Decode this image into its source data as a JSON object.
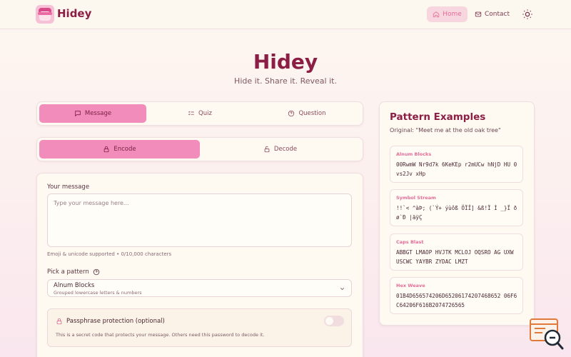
{
  "app": {
    "brand": "Hidey"
  },
  "nav": {
    "home": "Home",
    "contact": "Contact",
    "theme_icon": "sun-icon"
  },
  "hero": {
    "title": "Hidey",
    "subtitle": "Hide it. Share it. Reveal it."
  },
  "mode_tabs": [
    {
      "label": "Message",
      "icon": "speech-bubble-icon",
      "active": true
    },
    {
      "label": "Quiz",
      "icon": "checklist-icon",
      "active": false
    },
    {
      "label": "Question",
      "icon": "help-circle-icon",
      "active": false
    }
  ],
  "action_tabs": [
    {
      "label": "Encode",
      "icon": "lock-icon",
      "active": true
    },
    {
      "label": "Decode",
      "icon": "unlock-icon",
      "active": false
    }
  ],
  "form": {
    "message_label": "Your message",
    "message_placeholder": "Type your message here...",
    "message_help": "Emoji & unicode supported • 0/10,000 characters",
    "pattern_label": "Pick a pattern",
    "pattern_value": "Alnum Blocks",
    "pattern_desc": "Grouped lowercase letters & numbers",
    "passphrase_label": "Passphrase protection (optional)",
    "passphrase_help": "This is a secret code that protects your message. Others need this password to decode it.",
    "passphrase_enabled": false
  },
  "examples": {
    "title": "Pattern Examples",
    "original": "Original: \"Meet me at the old oak tree\"",
    "items": [
      {
        "name": "Alnum Blocks",
        "code": "00RwmW Nr9d7k 6KeKEp r2mUCw hNjD HU 0vs2Jv xHp"
      },
      {
        "name": "Symbol Stream",
        "code": "!!`< ^àÞ; (`Ý+ ýùôß ÖÏÎ] &ß!Ï Ì _}Ï ðø`Ð |äÿÇ"
      },
      {
        "name": "Caps Blast",
        "code": "ABBGT LMAOP HVJTK MCLOJ OQSRO AG UXW USCWC YAYBR ZYDAC LMZT"
      },
      {
        "name": "Hex Weave",
        "code": "01B4D656574206D65206174207468652 06F6C64206F616B2074726565"
      }
    ]
  },
  "colors": {
    "accent": "#f28dbb",
    "brand": "#8c1d45",
    "bg": "#fdf7f0"
  }
}
